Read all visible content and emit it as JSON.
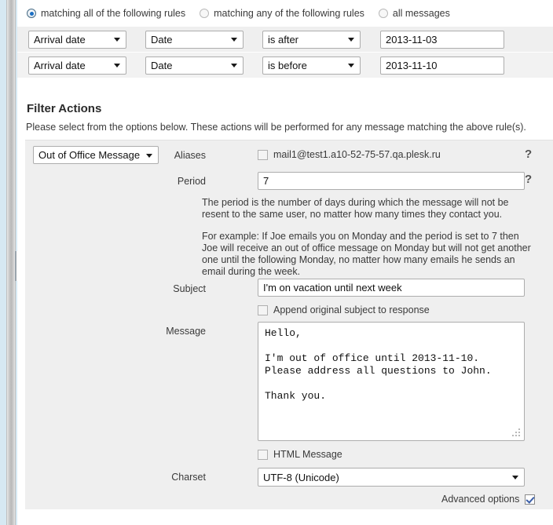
{
  "match_options": [
    {
      "label": "matching all of the following rules",
      "selected": true
    },
    {
      "label": "matching any of the following rules",
      "selected": false
    },
    {
      "label": "all messages",
      "selected": false
    }
  ],
  "rules": [
    {
      "field": "Arrival date",
      "type": "Date",
      "operator": "is after",
      "value": "2013-11-03"
    },
    {
      "field": "Arrival date",
      "type": "Date",
      "operator": "is before",
      "value": "2013-11-10"
    }
  ],
  "filter_actions": {
    "title": "Filter Actions",
    "description": "Please select from the options below. These actions will be performed for any message matching the above rule(s).",
    "action_type": "Out of Office Message",
    "aliases": {
      "label": "Aliases",
      "value": "mail1@test1.a10-52-75-57.qa.plesk.ru",
      "checked": false,
      "help": "?"
    },
    "period": {
      "label": "Period",
      "value": "7",
      "help": "?"
    },
    "period_note_1": "The period is the number of days during which the message will not be resent to the same user, no matter how many times they contact you.",
    "period_note_2": "For example: If Joe emails you on Monday and the period is set to 7 then Joe will receive an out of office message on Monday but will not get another one until the following Monday, no matter how many emails he sends an email during the week.",
    "subject": {
      "label": "Subject",
      "value": "I'm on vacation until next week"
    },
    "append_subject": {
      "label": "Append original subject to response",
      "checked": false
    },
    "message": {
      "label": "Message",
      "value": "Hello,\n\nI'm out of office until 2013-11-10.\nPlease address all questions to John.\n\nThank you."
    },
    "html_message": {
      "label": "HTML Message",
      "checked": false
    },
    "charset": {
      "label": "Charset",
      "value": "UTF-8 (Unicode)"
    },
    "advanced_options": {
      "label": "Advanced options",
      "checked": true
    }
  },
  "colors": {
    "panel_bg": "#efefef",
    "gutter_bg": "#d6e8f2",
    "radio_accent": "#1b6fc4",
    "check_accent": "#3b5ea8"
  }
}
